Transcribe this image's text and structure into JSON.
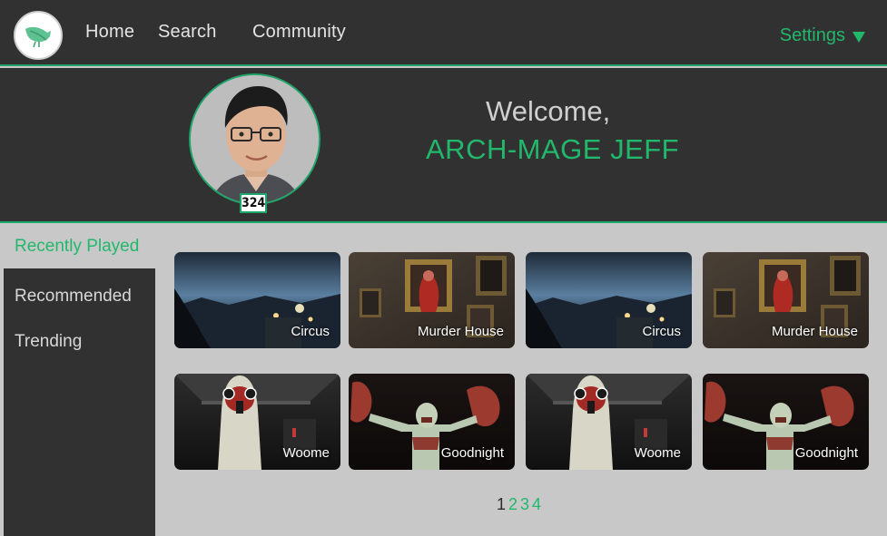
{
  "nav": {
    "logo_icon": "leaf-bird-icon",
    "links": [
      "Home",
      "Search",
      "Community"
    ],
    "settings_label": "Settings",
    "settings_icon": "caret-down-icon"
  },
  "profile": {
    "welcome": "Welcome,",
    "username": "ARCH-MAGE JEFF",
    "level": "324",
    "avatar_icon": "user-avatar-photo"
  },
  "sidebar": {
    "items": [
      "Recently Played",
      "Recommended",
      "Trending"
    ],
    "active": "Recently Played"
  },
  "games": [
    {
      "title": "Circus",
      "art": "circus"
    },
    {
      "title": "Murder House",
      "art": "murder"
    },
    {
      "title": "Circus",
      "art": "circus"
    },
    {
      "title": "Murder House",
      "art": "murder"
    },
    {
      "title": "Woome",
      "art": "woome"
    },
    {
      "title": "Goodnight",
      "art": "goodnight"
    },
    {
      "title": "Woome",
      "art": "woome"
    },
    {
      "title": "Goodnight",
      "art": "goodnight"
    }
  ],
  "pagination": {
    "pages": [
      "1",
      "2",
      "3",
      "4"
    ],
    "current": "1"
  },
  "colors": {
    "accent": "#22b86c",
    "dark_panel": "#313131",
    "content_bg": "#c8c8c8"
  }
}
